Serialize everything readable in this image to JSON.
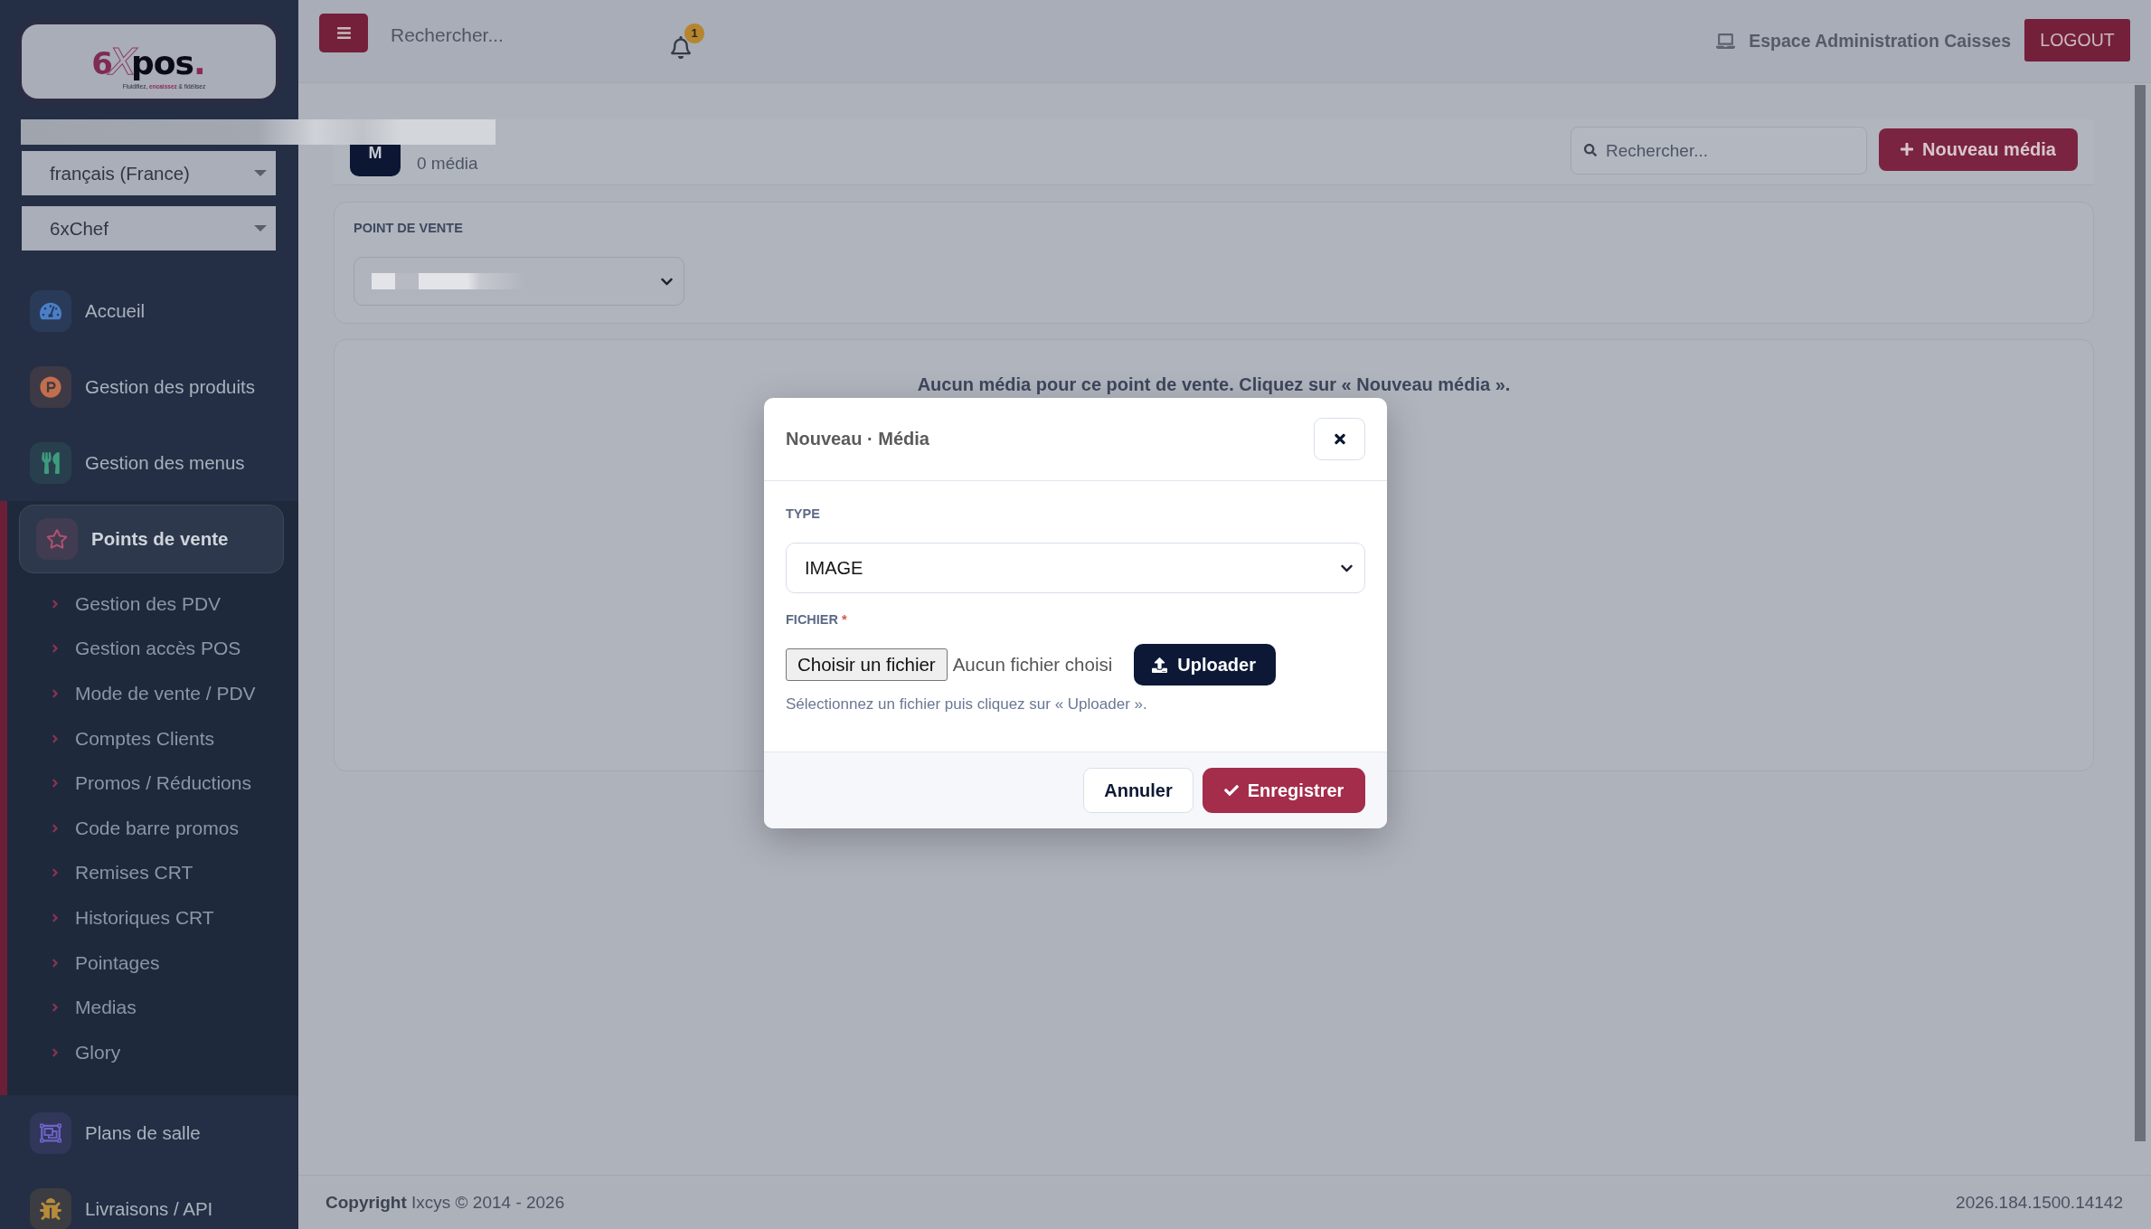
{
  "sidebar": {
    "logo": {
      "wordmark": "6xpos.",
      "tagline": "Fluidifiez, **encaissez** & fidélisez"
    },
    "language_select": {
      "value": "français (France)"
    },
    "company_select": {
      "value": "6xChef"
    },
    "menu": [
      {
        "label": "Accueil",
        "color": "#4a7fc8",
        "selected": false
      },
      {
        "label": "Gestion des produits",
        "color": "#c26e4c",
        "selected": false
      },
      {
        "label": "Gestion des menus",
        "color": "#3f9b7d",
        "selected": false
      },
      {
        "label": "Points de vente",
        "color": "#b0516f",
        "selected": true,
        "children": [
          {
            "label": "Gestion des PDV"
          },
          {
            "label": "Gestion accès POS"
          },
          {
            "label": "Mode de vente / PDV"
          },
          {
            "label": "Comptes Clients"
          },
          {
            "label": "Promos / Réductions"
          },
          {
            "label": "Code barre promos"
          },
          {
            "label": "Remises CRT"
          },
          {
            "label": "Historiques CRT"
          },
          {
            "label": "Pointages"
          },
          {
            "label": "Medias"
          },
          {
            "label": "Glory"
          }
        ]
      },
      {
        "label": "Plans de salle",
        "color": "#6f63c9",
        "selected": false
      },
      {
        "label": "Livraisons / API",
        "color": "#b78b3a",
        "selected": false
      }
    ]
  },
  "topbar": {
    "search": {
      "placeholder": "Rechercher..."
    },
    "notification_count": "1",
    "workspace": "Espace Administration Caisses",
    "logout_button": "LOGOUT"
  },
  "media_header": {
    "avatar": "M",
    "count": "0 média",
    "search": {
      "placeholder": "Rechercher..."
    },
    "new_button": "Nouveau média"
  },
  "store_filter": {
    "label": "POINT DE VENTE"
  },
  "empty_state": {
    "message": "Aucun média pour ce point de vente. Cliquez sur « Nouveau média »."
  },
  "dialog": {
    "title": "Nouveau · Média",
    "type": {
      "label": "TYPE",
      "value": "IMAGE"
    },
    "file": {
      "label": "FICHIER",
      "required_mark": "*",
      "choose_button": "Choisir un fichier",
      "status": "Aucun fichier choisi",
      "upload_button": "Uploader",
      "help": "Sélectionnez un fichier puis cliquez sur « Uploader »."
    },
    "cancel_button": "Annuler",
    "save_button": "Enregistrer"
  },
  "footer": {
    "copyright": "**Copyright** Ixcys © 2014 - 2026",
    "version": "2026.184.1500.14142"
  }
}
